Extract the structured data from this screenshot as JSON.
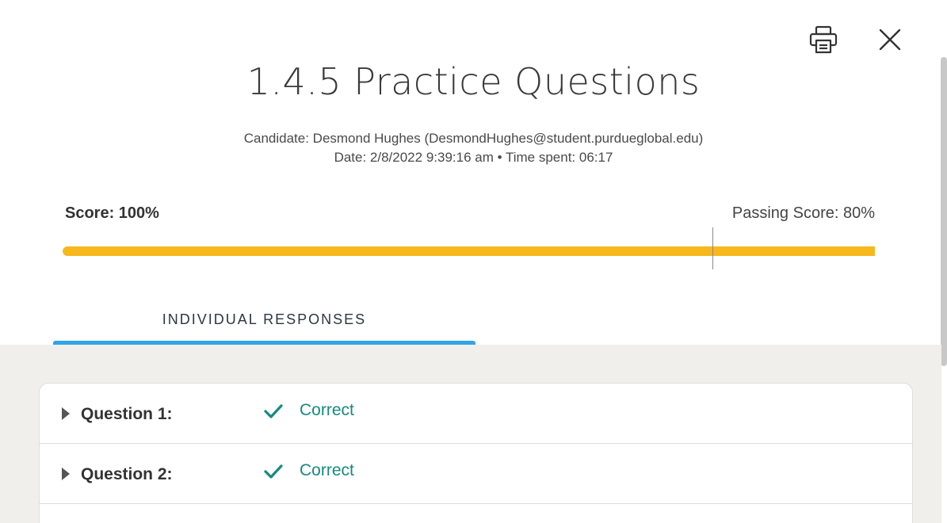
{
  "header": {
    "print_icon": "printer-icon",
    "close_icon": "close-icon"
  },
  "title": "1.4.5 Practice Questions",
  "meta": {
    "candidate_line": "Candidate: Desmond Hughes  (DesmondHughes@student.purdueglobal.edu)",
    "date_line": "Date: 2/8/2022 9:39:16 am • Time spent: 06:17"
  },
  "score": {
    "label": "Score: 100%",
    "passing_label": "Passing Score: 80%",
    "value_percent": 100,
    "passing_percent": 80,
    "bar_color": "#f6b81c"
  },
  "tabs": [
    {
      "label": "INDIVIDUAL RESPONSES",
      "active": true,
      "accent": "#2fa4e7"
    }
  ],
  "questions": [
    {
      "label": "Question 1:",
      "status": "Correct",
      "status_icon": "checkmark-icon"
    },
    {
      "label": "Question 2:",
      "status": "Correct",
      "status_icon": "checkmark-icon"
    }
  ],
  "colors": {
    "correct": "#168a7e",
    "panel_bg": "#f0efec"
  }
}
